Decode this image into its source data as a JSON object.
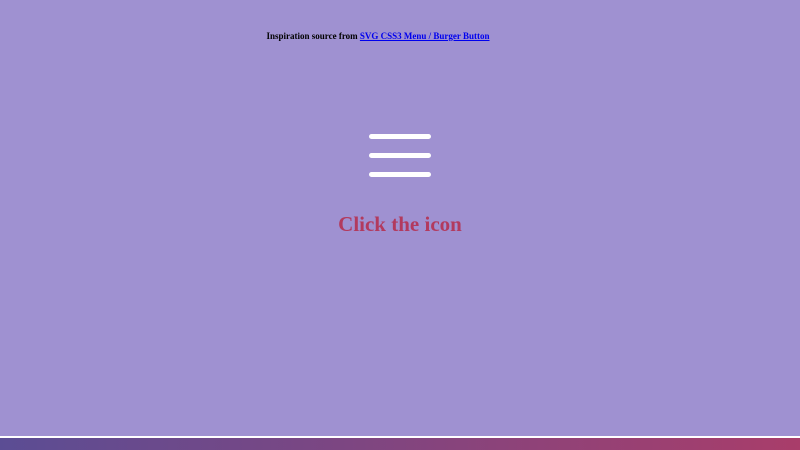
{
  "credit": {
    "prefix": "Inspiration source from ",
    "link_text": "SVG CSS3 Menu / Burger Button"
  },
  "menu_button": {
    "icon": "hamburger-menu-icon",
    "color": "#ffffff"
  },
  "caption": "Click the icon",
  "colors": {
    "background": "#9f91d1",
    "caption": "#b23a5e",
    "footer_gradient_start": "#5b4d94",
    "footer_gradient_end": "#a93d6a"
  }
}
